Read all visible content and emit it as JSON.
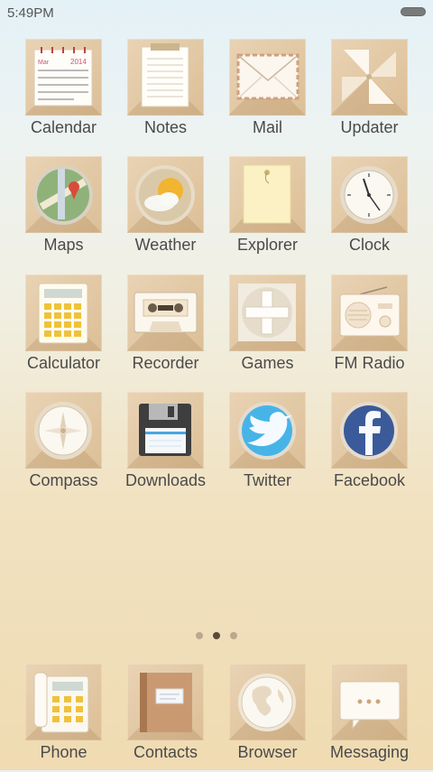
{
  "status": {
    "time": "5:49PM"
  },
  "apps": {
    "calendar": {
      "label": "Calendar",
      "month": "Mar",
      "year": "2014"
    },
    "notes": {
      "label": "Notes"
    },
    "mail": {
      "label": "Mail"
    },
    "updater": {
      "label": "Updater"
    },
    "maps": {
      "label": "Maps"
    },
    "weather": {
      "label": "Weather"
    },
    "explorer": {
      "label": "Explorer"
    },
    "clock": {
      "label": "Clock"
    },
    "calculator": {
      "label": "Calculator"
    },
    "recorder": {
      "label": "Recorder"
    },
    "games": {
      "label": "Games"
    },
    "fmradio": {
      "label": "FM Radio"
    },
    "compass": {
      "label": "Compass"
    },
    "downloads": {
      "label": "Downloads"
    },
    "twitter": {
      "label": "Twitter"
    },
    "facebook": {
      "label": "Facebook"
    }
  },
  "dock": {
    "phone": {
      "label": "Phone"
    },
    "contacts": {
      "label": "Contacts"
    },
    "browser": {
      "label": "Browser"
    },
    "messaging": {
      "label": "Messaging"
    }
  },
  "pager": {
    "pages": 3,
    "active_index": 1
  },
  "colors": {
    "tile": "#dcbf97",
    "label": "#4a4a4a",
    "accent_blue": "#3b7fc4"
  }
}
